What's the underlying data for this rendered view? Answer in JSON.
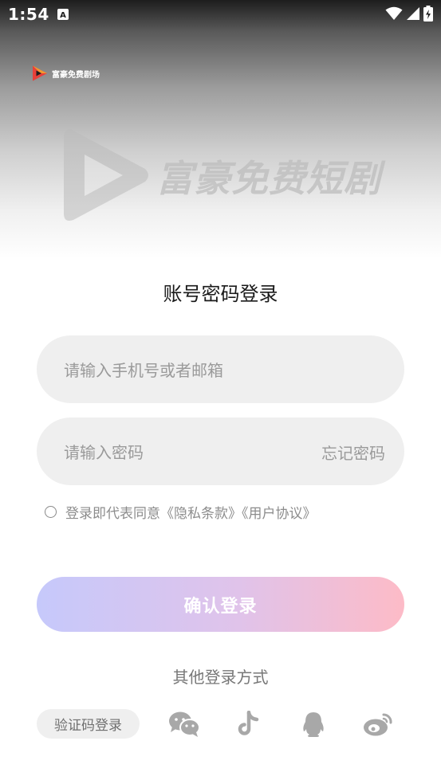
{
  "status_bar": {
    "time": "1:54",
    "notification_icon": "a-notification-icon",
    "wifi_icon": "wifi-icon",
    "signal_icon": "cell-signal-icon",
    "battery_icon": "battery-charging-icon"
  },
  "brand": {
    "name_small": "富豪免费剧场",
    "watermark_text": "富豪免费短剧",
    "logo_icon": "play-logo-icon",
    "colors": {
      "logo_red": "#e8403a",
      "logo_orange": "#f29a2e"
    }
  },
  "login": {
    "title": "账号密码登录",
    "account_placeholder": "请输入手机号或者邮箱",
    "password_placeholder": "请输入密码",
    "forgot_label": "忘记密码",
    "agreement_text": "登录即代表同意《隐私条款》《用户协议》",
    "confirm_label": "确认登录",
    "confirm_gradient": [
      "#c6c9fb",
      "#fdbbc7"
    ]
  },
  "other_login": {
    "label": "其他登录方式",
    "sms_label": "验证码登录",
    "icons": [
      "wechat-icon",
      "tiktok-icon",
      "qq-icon",
      "weibo-icon"
    ]
  }
}
